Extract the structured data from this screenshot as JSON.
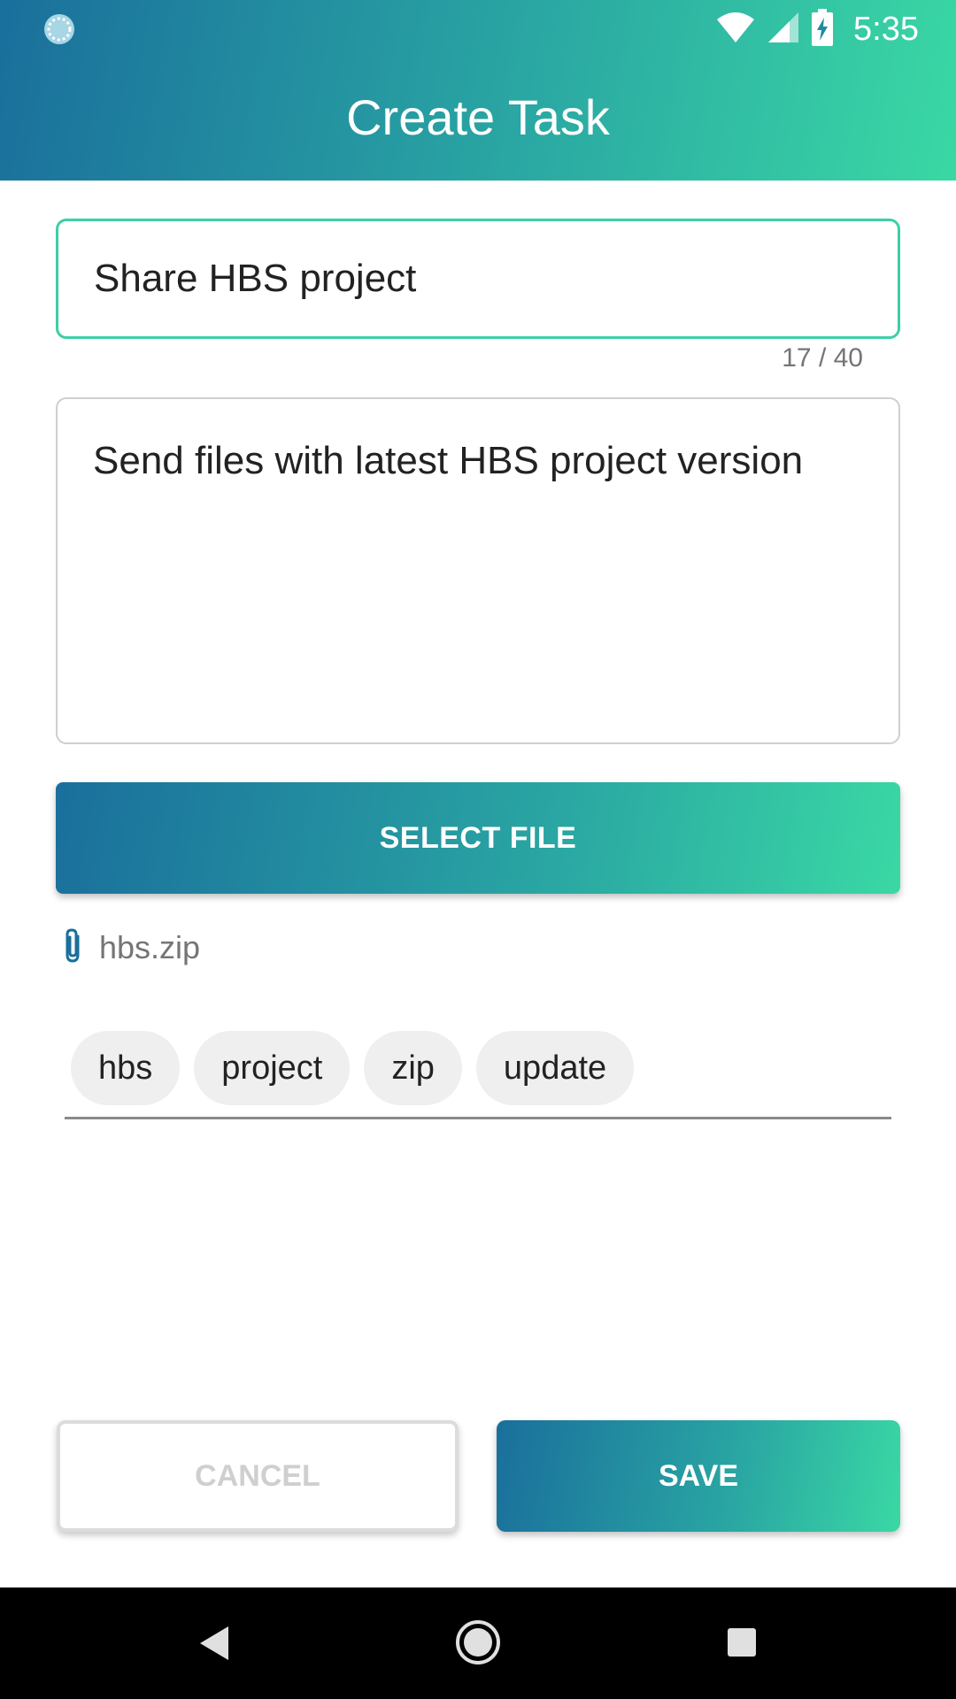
{
  "status_bar": {
    "time": "5:35",
    "icons": [
      "sync-icon",
      "wifi-icon",
      "cellular-signal-icon",
      "battery-charging-icon"
    ]
  },
  "header": {
    "title": "Create Task"
  },
  "form": {
    "title_value": "Share HBS project",
    "title_counter": "17 / 40",
    "description_value": "Send files with latest HBS project version",
    "select_file_label": "SELECT FILE",
    "attachment": {
      "icon": "paperclip-icon",
      "file_name": "hbs.zip"
    },
    "tags": [
      "hbs",
      "project",
      "zip",
      "update"
    ]
  },
  "actions": {
    "cancel_label": "CANCEL",
    "save_label": "SAVE"
  },
  "nav_bar": {
    "icons": [
      "back-icon",
      "home-icon",
      "recents-icon"
    ]
  },
  "colors": {
    "gradient_start": "#1a6f9c",
    "gradient_end": "#3ad8a4",
    "focus_border": "#3ccfa6"
  }
}
